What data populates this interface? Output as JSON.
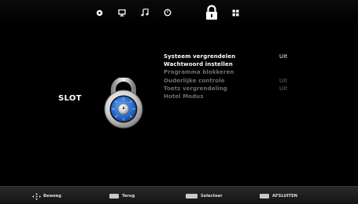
{
  "topbar": {
    "tabs": [
      {
        "icon": "picture-icon"
      },
      {
        "icon": "monitor-icon"
      },
      {
        "icon": "music-note-icon"
      },
      {
        "icon": "clock-icon"
      },
      {
        "icon": "lock-icon",
        "selected": true
      },
      {
        "icon": "options-grid-icon"
      }
    ]
  },
  "page": {
    "section_title": "SLOT",
    "section_icon": "combination-lock-icon"
  },
  "menu": {
    "items": [
      {
        "label": "Systeem vergrendelen",
        "value": "Uit",
        "enabled": true
      },
      {
        "label": "Wachtwoord instellen",
        "value": "",
        "enabled": true
      },
      {
        "label": "Programma blokkeren",
        "value": "",
        "enabled": false
      },
      {
        "label": "Ouderlijke controle",
        "value": "Uit",
        "enabled": false
      },
      {
        "label": "Toets vergrendeling",
        "value": "Uit",
        "enabled": false
      },
      {
        "label": "Hotel Modus",
        "value": "",
        "enabled": false
      }
    ]
  },
  "bottombar": {
    "hints": [
      {
        "key": "",
        "label": "Beweeg",
        "icon": "navigation-arrows-icon"
      },
      {
        "key": "MENU",
        "label": "Terug"
      },
      {
        "key": "ENTER",
        "label": "Selecteer"
      },
      {
        "key": "EXIT",
        "label": "AFSLUITEN"
      }
    ]
  },
  "colors": {
    "background": "#000000",
    "text_enabled": "#ffffff",
    "text_disabled": "#6e6e6e",
    "lock_blue": "#2a6fd0"
  }
}
